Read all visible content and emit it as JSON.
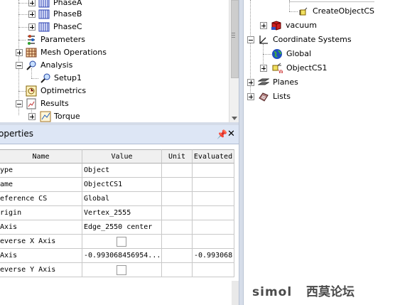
{
  "project_tree": {
    "items": [
      {
        "label": "PhaseA",
        "icon": "winding-icon"
      },
      {
        "label": "PhaseB",
        "icon": "winding-icon"
      },
      {
        "label": "PhaseC",
        "icon": "winding-icon"
      },
      {
        "label": "Parameters",
        "icon": "parameters-icon"
      },
      {
        "label": "Mesh Operations",
        "icon": "mesh-icon"
      },
      {
        "label": "Analysis",
        "icon": "analysis-icon"
      },
      {
        "label": "Setup1",
        "icon": "setup-icon"
      },
      {
        "label": "Optimetrics",
        "icon": "optimetrics-icon"
      },
      {
        "label": "Results",
        "icon": "results-icon"
      },
      {
        "label": "Torque",
        "icon": "plot-icon"
      }
    ]
  },
  "properties": {
    "title": "operties",
    "pin_glyph": "p",
    "close_glyph": "✕",
    "columns": [
      "Name",
      "Value",
      "Unit",
      "Evaluated"
    ],
    "rows": [
      {
        "name": "ype",
        "value": "Object",
        "unit": "",
        "evaluated": ""
      },
      {
        "name": "ame",
        "value": "ObjectCS1",
        "unit": "",
        "evaluated": ""
      },
      {
        "name": "eference CS",
        "value": "Global",
        "unit": "",
        "evaluated": ""
      },
      {
        "name": "rigin",
        "value": "Vertex_2555",
        "unit": "",
        "evaluated": ""
      },
      {
        "name": " Axis",
        "value": "Edge_2550 center",
        "unit": "",
        "evaluated": ""
      },
      {
        "name": "everse X Axis",
        "value": "",
        "checkbox": true,
        "checked": false,
        "unit": "",
        "evaluated": ""
      },
      {
        "name": " Axis",
        "value": "-0.993068456954...",
        "unit": "",
        "evaluated": "-0.993068"
      },
      {
        "name": "everse Y Axis",
        "value": "",
        "checkbox": true,
        "checked": false,
        "unit": "",
        "evaluated": ""
      }
    ]
  },
  "model_tree": {
    "items": [
      {
        "label": "CreateObjectCS",
        "icon": "coordinate-system-icon"
      },
      {
        "label": "vacuum",
        "icon": "material-icon"
      },
      {
        "label": "Coordinate Systems",
        "icon": "axes-icon"
      },
      {
        "label": "Global",
        "icon": "globe-icon"
      },
      {
        "label": "ObjectCS1",
        "icon": "object-cs-icon"
      },
      {
        "label": "Planes",
        "icon": "planes-icon"
      },
      {
        "label": "Lists",
        "icon": "lists-icon"
      }
    ]
  },
  "watermark": {
    "text": "SIMOL 西莫论坛"
  },
  "colors": {
    "panel_title": "#dde6f5",
    "grid_line": "#c8c8c8",
    "accent_blue": "#2050c0"
  }
}
